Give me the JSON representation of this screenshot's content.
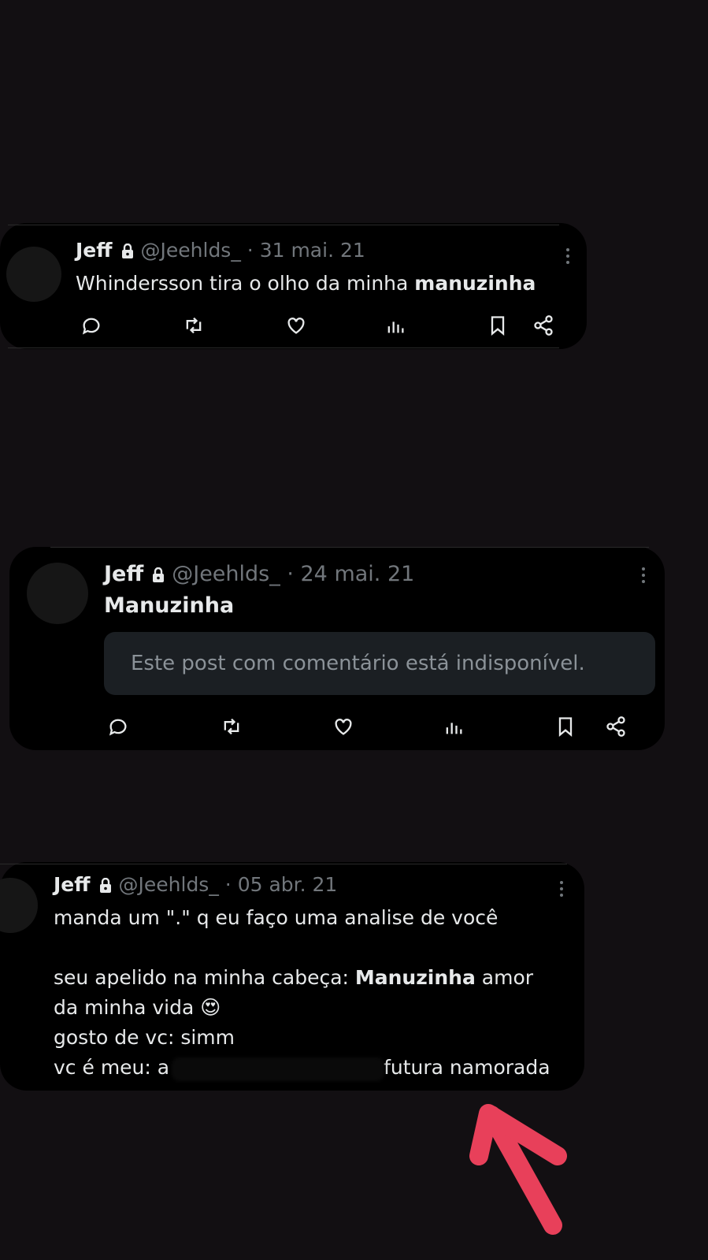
{
  "tweets": [
    {
      "name": "Jeff",
      "handle": "@Jeehlds_",
      "date": "· 31 mai. 21",
      "text_plain": "Whindersson tira o olho da minha ",
      "text_bold": "manuzinha"
    },
    {
      "name": "Jeff",
      "handle": "@Jeehlds_",
      "date": "· 24 mai. 21",
      "text_bold": "Manuzinha",
      "quote": "Este post com comentário está indisponível."
    },
    {
      "name": "Jeff",
      "handle": "@Jeehlds_",
      "date": "· 05 abr. 21",
      "line1": "manda um \".\" q eu faço uma analise de você",
      "line2_plain": "seu apelido na minha cabeça: ",
      "line2_bold": "Manuzinha",
      "line2_tail": " amor",
      "line3": "da minha vida 😍",
      "line4": "gosto de vc: simm",
      "line5_start": "vc é meu: a",
      "line5_end": "futura namorada"
    }
  ],
  "icons": [
    "reply-icon",
    "retweet-icon",
    "like-icon",
    "views-icon",
    "bookmark-icon",
    "share-icon",
    "lock-icon",
    "more-icon"
  ],
  "colors": {
    "background": "#120f12",
    "card": "#000000",
    "text": "#e7e9ea",
    "muted": "#71767b",
    "arrow": "#e8405a"
  }
}
